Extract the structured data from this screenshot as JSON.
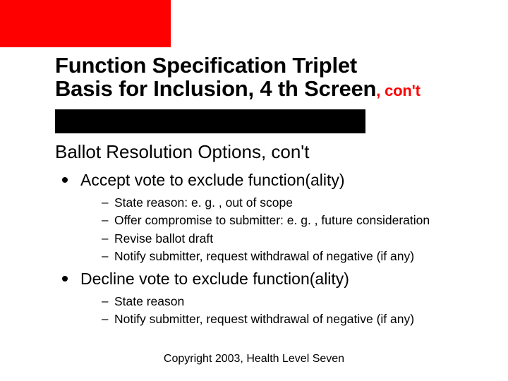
{
  "title": {
    "line1": "Function Specification Triplet",
    "line2_main": "Basis for Inclusion, 4 th Screen",
    "line2_cont": ", con't"
  },
  "subhead": "Ballot Resolution Options, con't",
  "bullets": [
    {
      "text": "Accept vote to exclude function(ality)",
      "sub": [
        "State reason:  e. g. , out of scope",
        "Offer compromise to submitter:  e. g. , future consideration",
        "Revise ballot draft",
        "Notify submitter, request withdrawal of negative (if any)"
      ]
    },
    {
      "text": "Decline vote to exclude function(ality)",
      "sub": [
        "State reason",
        "Notify submitter, request withdrawal of negative (if any)"
      ]
    }
  ],
  "footer": "Copyright 2003, Health Level Seven"
}
